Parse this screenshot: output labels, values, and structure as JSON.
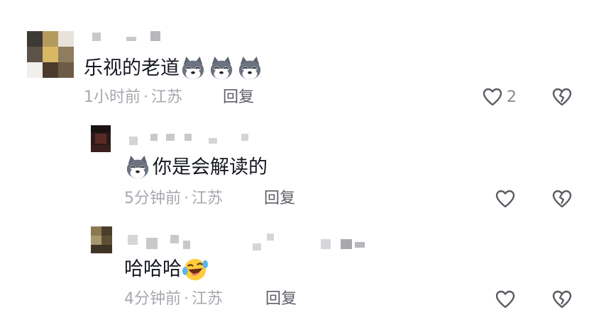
{
  "comments": [
    {
      "text": "乐视的老道",
      "time": "1小时前",
      "separator": "·",
      "location": "江苏",
      "reply_label": "回复",
      "like_count": "2",
      "emojis": [
        "husky-dog-emoji",
        "husky-dog-emoji",
        "husky-dog-emoji"
      ]
    },
    {
      "text": "你是会解读的",
      "time": "5分钟前",
      "separator": "·",
      "location": "江苏",
      "reply_label": "回复",
      "emojis": [
        "husky-dog-emoji"
      ]
    },
    {
      "text": "哈哈哈",
      "time": "4分钟前",
      "separator": "·",
      "location": "江苏",
      "reply_label": "回复",
      "emojis": [
        "laughing-tears-emoji"
      ]
    }
  ],
  "colors": {
    "text": "#161823",
    "meta": "#a7a8ae",
    "reply": "#5f6069",
    "icon": "#5a5b62"
  }
}
